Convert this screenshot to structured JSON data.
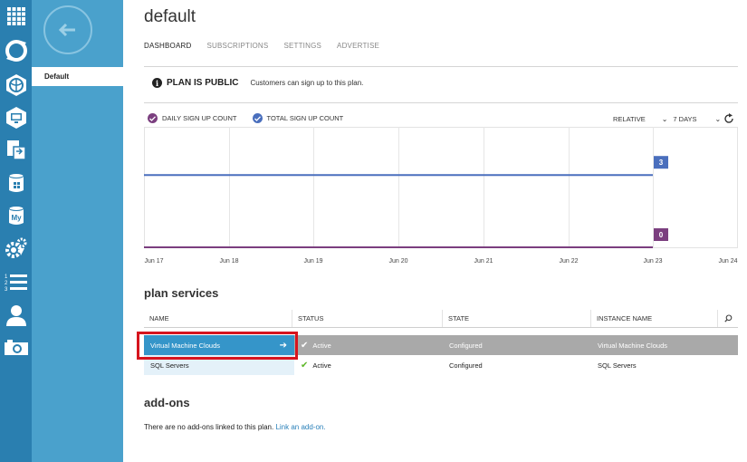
{
  "page": {
    "title": "default"
  },
  "subnav": {
    "selected_item": "Default"
  },
  "tabs": [
    "DASHBOARD",
    "SUBSCRIPTIONS",
    "SETTINGS",
    "ADVERTISE"
  ],
  "banner": {
    "title": "PLAN IS PUBLIC",
    "text": "Customers can sign up to this plan.",
    "info_icon": "i"
  },
  "legend": {
    "daily": "DAILY SIGN UP COUNT",
    "total": "TOTAL SIGN UP COUNT"
  },
  "controls": {
    "mode": "RELATIVE",
    "range": "7 DAYS"
  },
  "chart_data": {
    "type": "line",
    "x": [
      "Jun 17",
      "Jun 18",
      "Jun 19",
      "Jun 20",
      "Jun 21",
      "Jun 22",
      "Jun 23",
      "Jun 24"
    ],
    "series": [
      {
        "name": "TOTAL SIGN UP COUNT",
        "color": "#4a6fbd",
        "values": [
          3,
          3,
          3,
          3,
          3,
          3,
          3
        ]
      },
      {
        "name": "DAILY SIGN UP COUNT",
        "color": "#7b3f7f",
        "values": [
          0,
          0,
          0,
          0,
          0,
          0,
          0
        ]
      }
    ],
    "end_labels": [
      "3",
      "0"
    ],
    "ylim": [
      0,
      5
    ],
    "grid": true
  },
  "services": {
    "heading": "plan services",
    "columns": [
      "NAME",
      "STATUS",
      "STATE",
      "INSTANCE NAME"
    ],
    "rows": [
      {
        "name": "Virtual Machine Clouds",
        "status": "Active",
        "state": "Configured",
        "instance": "Virtual Machine Clouds"
      },
      {
        "name": "SQL Servers",
        "status": "Active",
        "state": "Configured",
        "instance": "SQL Servers"
      }
    ],
    "check_glyph": "✔",
    "arrow_glyph": "➔"
  },
  "addons": {
    "heading": "add-ons",
    "text": "There are no add-ons linked to this plan.",
    "link": "Link an add-on."
  },
  "rail_icons": [
    "grid-icon",
    "automation-icon",
    "web-sites-icon",
    "virtual-machines-icon",
    "provisioning-icon",
    "sql-database-icon",
    "mysql-database-icon",
    "settings-icon",
    "plans-icon",
    "user-icon",
    "camera-icon"
  ]
}
